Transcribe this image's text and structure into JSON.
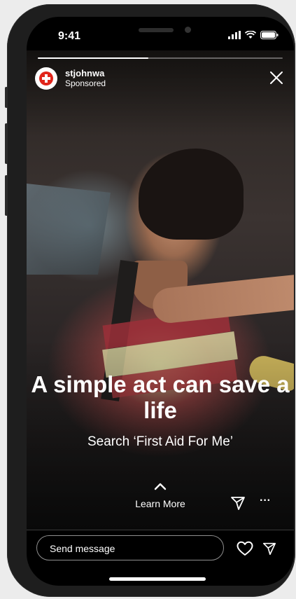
{
  "status_bar": {
    "time": "9:41"
  },
  "story": {
    "progress": 0.45,
    "account": {
      "username": "stjohnwa",
      "label": "Sponsored",
      "logo_text": "St John"
    },
    "headline": "A simple act can save a life",
    "subline": "Search ‘First Aid For Me’",
    "cta": {
      "label": "Learn More"
    }
  },
  "reply_bar": {
    "placeholder": "Send message"
  },
  "colors": {
    "brand_red": "#e1251b",
    "background": "#000000",
    "text": "#ffffff"
  },
  "icons": [
    "signal-icon",
    "wifi-icon",
    "battery-icon",
    "close-icon",
    "chevron-up-icon",
    "send-icon",
    "more-icon",
    "heart-icon"
  ]
}
